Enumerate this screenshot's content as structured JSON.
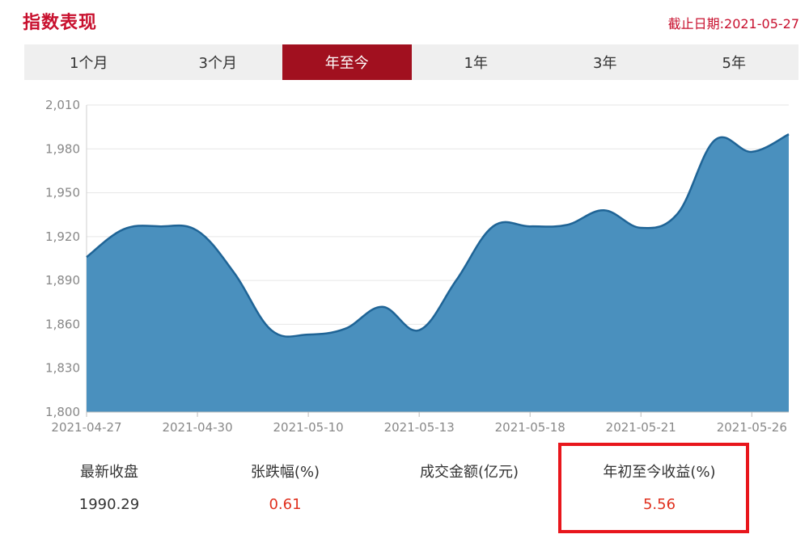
{
  "header": {
    "title": "指数表现",
    "cutoff_label": "截止日期:",
    "cutoff_date": "2021-05-27"
  },
  "tabs": [
    {
      "label": "1个月",
      "active": false
    },
    {
      "label": "3个月",
      "active": false
    },
    {
      "label": "年至今",
      "active": true
    },
    {
      "label": "1年",
      "active": false
    },
    {
      "label": "3年",
      "active": false
    },
    {
      "label": "5年",
      "active": false
    }
  ],
  "stats": {
    "latest_close": {
      "label": "最新收盘",
      "value": "1990.29"
    },
    "change_pct": {
      "label": "张跌幅(%)",
      "value": "0.61"
    },
    "turnover": {
      "label": "成交金额(亿元)",
      "value": ""
    },
    "ytd_return": {
      "label": "年初至今收益(%)",
      "value": "5.56"
    }
  },
  "colors": {
    "brand_red": "#c8102e",
    "active_tab": "#a1101f",
    "area_fill": "#4a90be",
    "line": "#1f6496",
    "value_red": "#e0301e",
    "highlight_box": "#e8161c"
  },
  "chart_data": {
    "type": "area",
    "xlabel": "",
    "ylabel": "",
    "ylim": [
      1800,
      2010
    ],
    "yticks": [
      1800,
      1830,
      1860,
      1890,
      1920,
      1950,
      1980,
      2010
    ],
    "ytick_labels": [
      "1,800",
      "1,830",
      "1,860",
      "1,890",
      "1,920",
      "1,950",
      "1,980",
      "2,010"
    ],
    "x": [
      "2021-04-27",
      "2021-04-28",
      "2021-04-29",
      "2021-04-30",
      "2021-05-06",
      "2021-05-07",
      "2021-05-10",
      "2021-05-11",
      "2021-05-12",
      "2021-05-13",
      "2021-05-14",
      "2021-05-17",
      "2021-05-18",
      "2021-05-19",
      "2021-05-20",
      "2021-05-21",
      "2021-05-24",
      "2021-05-25",
      "2021-05-26",
      "2021-05-27"
    ],
    "xtick_labels": [
      "2021-04-27",
      "2021-04-30",
      "2021-05-10",
      "2021-05-13",
      "2021-05-18",
      "2021-05-21",
      "2021-05-26"
    ],
    "series": [
      {
        "values": [
          1906,
          1925,
          1927,
          1924,
          1895,
          1856,
          1853,
          1857,
          1872,
          1856,
          1890,
          1927,
          1927,
          1928,
          1938,
          1926,
          1936,
          1986,
          1978,
          1990
        ]
      }
    ],
    "grid": true
  }
}
